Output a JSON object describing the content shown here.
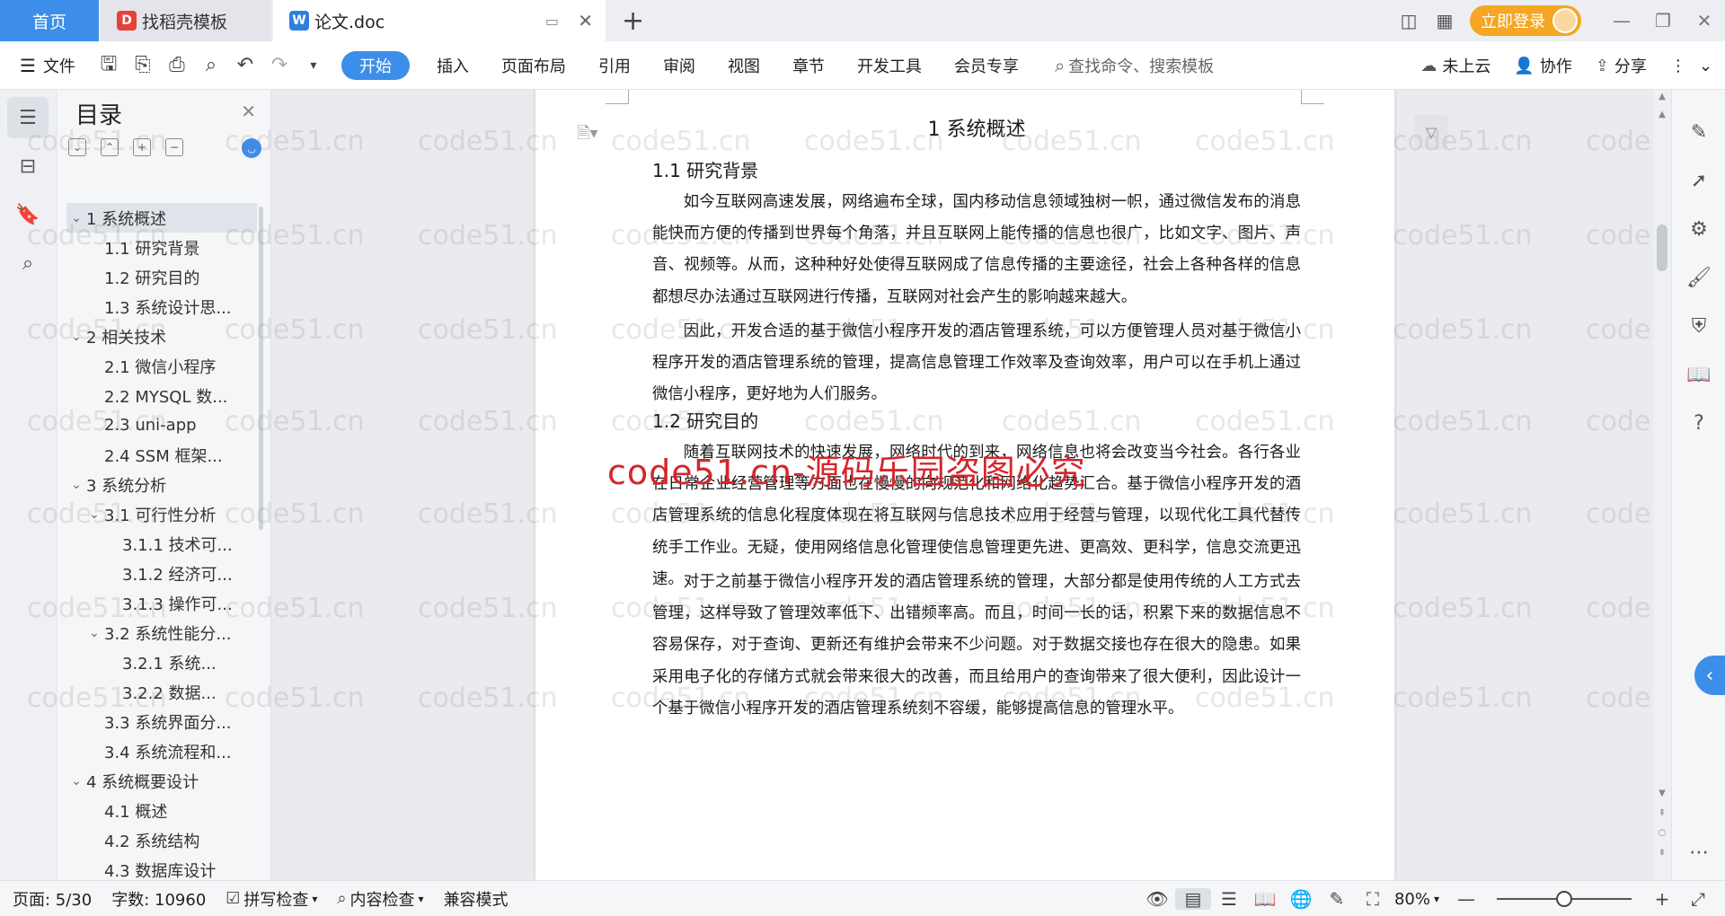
{
  "titlebar": {
    "tabs": [
      {
        "label": "首页"
      },
      {
        "label": "找稻壳模板"
      },
      {
        "label": "论文.doc"
      }
    ],
    "login_label": "立即登录"
  },
  "ribbon": {
    "file_label": "文件",
    "menus": [
      "开始",
      "插入",
      "页面布局",
      "引用",
      "审阅",
      "视图",
      "章节",
      "开发工具",
      "会员专享"
    ],
    "search_placeholder": "查找命令、搜索模板",
    "cloud_label": "未上云",
    "collab_label": "协作",
    "share_label": "分享"
  },
  "toc": {
    "title": "目录",
    "items": [
      {
        "label": "1 系统概述",
        "level": 1,
        "expanded": true,
        "selected": true
      },
      {
        "label": "1.1  研究背景",
        "level": 2
      },
      {
        "label": "1.2 研究目的",
        "level": 2
      },
      {
        "label": "1.3 系统设计思...",
        "level": 2
      },
      {
        "label": "2 相关技术",
        "level": 1,
        "expanded": true
      },
      {
        "label": "2.1 微信小程序",
        "level": 2
      },
      {
        "label": "2.2 MYSQL 数...",
        "level": 2
      },
      {
        "label": "2.3 uni-app",
        "level": 2
      },
      {
        "label": "2.4 SSM 框架...",
        "level": 2
      },
      {
        "label": "3 系统分析",
        "level": 1,
        "expanded": true
      },
      {
        "label": "3.1 可行性分析",
        "level": 2,
        "expanded": true
      },
      {
        "label": "3.1.1 技术可...",
        "level": 3
      },
      {
        "label": "3.1.2 经济可...",
        "level": 3
      },
      {
        "label": "3.1.3 操作可...",
        "level": 3
      },
      {
        "label": "3.2 系统性能分...",
        "level": 2,
        "expanded": true
      },
      {
        "label": "3.2.1  系统...",
        "level": 3
      },
      {
        "label": "3.2.2  数据...",
        "level": 3
      },
      {
        "label": "3.3 系统界面分...",
        "level": 2
      },
      {
        "label": "3.4 系统流程和...",
        "level": 2
      },
      {
        "label": "4 系统概要设计",
        "level": 1,
        "expanded": true
      },
      {
        "label": "4.1 概述",
        "level": 2
      },
      {
        "label": "4.2 系统结构",
        "level": 2
      },
      {
        "label": "4.3 数据库设计",
        "level": 2
      }
    ]
  },
  "document": {
    "h1": "1 系统概述",
    "h2_a": "1.1  研究背景",
    "p1": "如今互联网高速发展，网络遍布全球，国内移动信息领域独树一帜，通过微信发布的消息能快而方便的传播到世界每个角落，并且互联网上能传播的信息也很广，比如文字、图片、声音、视频等。从而，这种种好处使得互联网成了信息传播的主要途径，社会上各种各样的信息都想尽办法通过互联网进行传播，互联网对社会产生的影响越来越大。",
    "p2": "因此，开发合适的基于微信小程序开发的酒店管理系统，可以方便管理人员对基于微信小程序开发的酒店管理系统的管理，提高信息管理工作效率及查询效率，用户可以在手机上通过微信小程序，更好地为人们服务。",
    "h2_b": "1.2 研究目的",
    "p3": "随着互联网技术的快速发展，网络时代的到来，网络信息也将会改变当今社会。各行各业在日常企业经营管理等方面也在慢慢的向规范化和网络化趋势汇合。基于微信小程序开发的酒店管理系统的信息化程度体现在将互联网与信息技术应用于经营与管理，以现代化工具代替传统手工作业。无疑，使用网络信息化管理使信息管理更先进、更高效、更科学，信息交流更迅速。",
    "p4": "对于之前基于微信小程序开发的酒店管理系统的管理，大部分都是使用传统的人工方式去管理，这样导致了管理效率低下、出错频率高。而且，时间一长的话，积累下来的数据信息不容易保存，对于查询、更新还有维护会带来不少问题。对于数据交接也存在很大的隐患。如果采用电子化的存储方式就会带来很大的改善，而且给用户的查询带来了很大便利，因此设计一个基于微信小程序开发的酒店管理系统刻不容缓，能够提高信息的管理水平。"
  },
  "watermark": {
    "overlay": "code51.cn-源码乐园盗图必究",
    "tile": "code51.cn"
  },
  "statusbar": {
    "page": "页面: 5/30",
    "words": "字数: 10960",
    "spellcheck": "拼写检查",
    "content_check": "内容检查",
    "compat": "兼容模式",
    "zoom": "80%",
    "zoom_level": 0.5
  },
  "colors": {
    "accent": "#3d8ee8",
    "login": "#f5a623",
    "watermark_red": "#d6252c"
  }
}
